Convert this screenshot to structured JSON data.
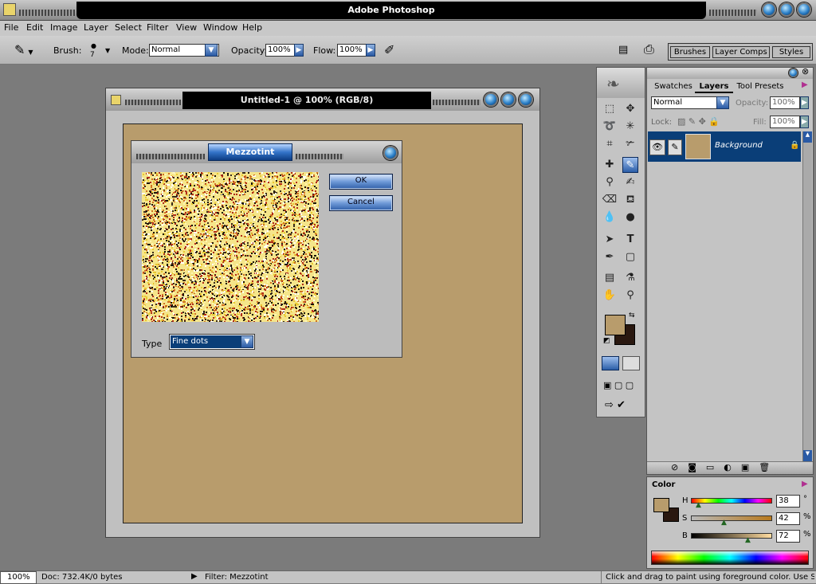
{
  "app": {
    "title": "Adobe Photoshop"
  },
  "menu": [
    "File",
    "Edit",
    "Image",
    "Layer",
    "Select",
    "Filter",
    "View",
    "Window",
    "Help"
  ],
  "options": {
    "brush_label": "Brush:",
    "brush_size": "7",
    "mode_label": "Mode:",
    "mode_value": "Normal",
    "opacity_label": "Opacity:",
    "opacity_value": "100%",
    "flow_label": "Flow:",
    "flow_value": "100%"
  },
  "palette_well": [
    "Brushes",
    "Layer Comps",
    "Styles"
  ],
  "document": {
    "title": "Untitled-1 @ 100% (RGB/8)",
    "canvas_color": "#b89c6c"
  },
  "dialog": {
    "title": "Mezzotint",
    "ok": "OK",
    "cancel": "Cancel",
    "type_label": "Type",
    "type_value": "Fine dots"
  },
  "layers_panel": {
    "tabs": [
      "Swatches",
      "Layers",
      "Tool Presets"
    ],
    "blend_mode": "Normal",
    "opacity_label": "Opacity:",
    "opacity_value": "100%",
    "lock_label": "Lock:",
    "fill_label": "Fill:",
    "fill_value": "100%",
    "layer_name": "Background"
  },
  "color_panel": {
    "title": "Color",
    "h_label": "H",
    "h_value": "38",
    "h_unit": "°",
    "s_label": "S",
    "s_value": "42",
    "s_unit": "%",
    "b_label": "B",
    "b_value": "72",
    "b_unit": "%",
    "foreground": "#b89c6c",
    "background": "#2a1810"
  },
  "status": {
    "zoom": "100%",
    "doc": "Doc: 732.4K/0 bytes",
    "filter": "Filter: Mezzotint",
    "hint": "Click and drag to paint using foreground color.  Use Shift,"
  },
  "colors": {
    "accent": "#0a3e78",
    "canvas": "#b89c6c"
  }
}
